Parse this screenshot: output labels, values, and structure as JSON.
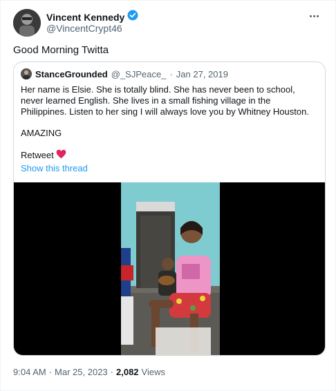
{
  "author": {
    "name": "Vincent Kennedy",
    "handle": "@VincentCrypt46",
    "verified_badge_color": "#1d9bf0"
  },
  "tweet": {
    "text": "Good Morning Twitta"
  },
  "quoted": {
    "name": "StanceGrounded",
    "handle": "@_SJPeace_",
    "separator": "·",
    "date": "Jan 27, 2019",
    "body": "Her name is Elsie. She is totally blind. She has never been to school, never learned English. She lives in a small fishing village in the Philippines. Listen to her sing I will always love you by Whitney Houston.",
    "amazing": "AMAZING",
    "retweet": "Retweet",
    "heart_color": "#e0245e",
    "show_thread": "Show this thread"
  },
  "footer": {
    "time": "9:04 AM",
    "dot1": "·",
    "date": "Mar 25, 2023",
    "dot2": "·",
    "views_count": "2,082",
    "views_label": "Views"
  },
  "icons": {
    "more": "more-icon",
    "verified": "verified-badge-icon",
    "heart": "heart-icon",
    "video": "video-player"
  }
}
